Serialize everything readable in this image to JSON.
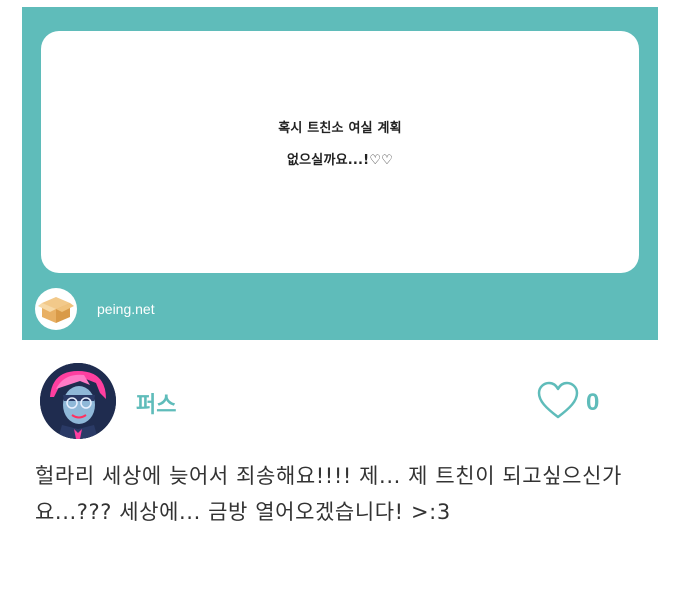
{
  "question": {
    "lines": [
      "혹시 트친소 여실 계획",
      "없으실까요...!♡♡"
    ]
  },
  "brand": {
    "site": "peing.net",
    "logo_icon": "box-icon"
  },
  "profile": {
    "username": "퍼스",
    "avatar_icon": "avatar-image"
  },
  "like": {
    "icon": "heart-outline-icon",
    "count": "0"
  },
  "answer": {
    "text": "헐라리 세상에 늦어서 죄송해요!!!! 제... 제 트친이 되고싶으신가요...??? 세상에... 금방 열어오겠습니다! >:3"
  },
  "colors": {
    "teal": "#5fbcba",
    "text": "#333333"
  }
}
